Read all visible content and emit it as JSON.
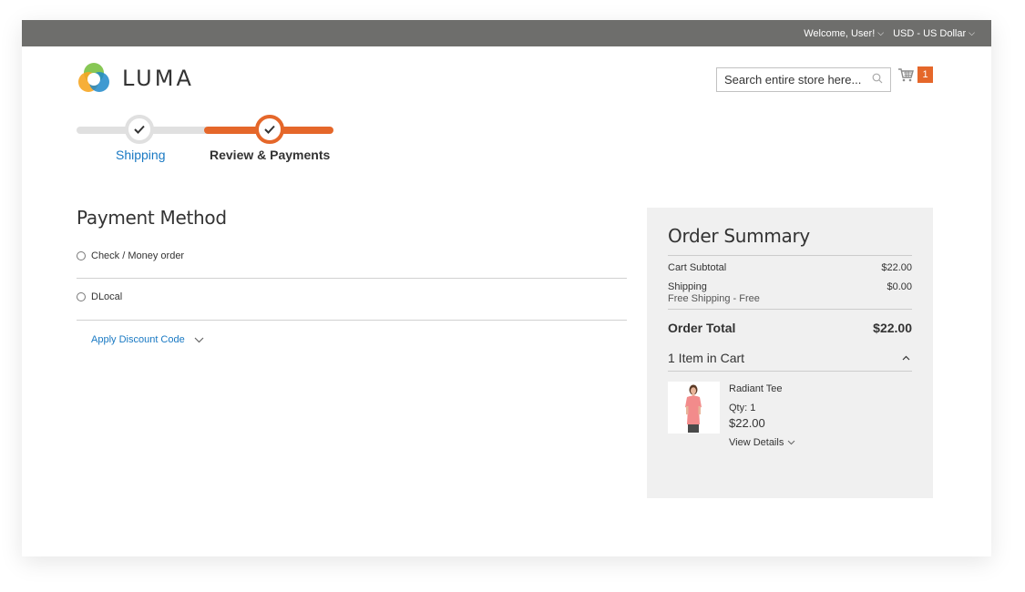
{
  "topbar": {
    "welcome": "Welcome, User!",
    "currency": "USD - US Dollar"
  },
  "header": {
    "logo_text": "LUMA",
    "search_placeholder": "Search entire store here...",
    "cart_count": "1"
  },
  "progress": {
    "steps": [
      {
        "label": "Shipping",
        "state": "complete"
      },
      {
        "label": "Review & Payments",
        "state": "active"
      }
    ]
  },
  "payment": {
    "title": "Payment Method",
    "options": [
      "Check / Money order",
      "DLocal"
    ],
    "discount_label": "Apply Discount Code"
  },
  "summary": {
    "title": "Order Summary",
    "subtotal_label": "Cart Subtotal",
    "subtotal_value": "$22.00",
    "shipping_label": "Shipping",
    "shipping_method": "Free Shipping - Free",
    "shipping_value": "$0.00",
    "total_label": "Order Total",
    "total_value": "$22.00",
    "items_label": "1 Item in Cart",
    "item": {
      "name": "Radiant Tee",
      "qty": "Qty: 1",
      "price": "$22.00",
      "details_label": "View Details"
    }
  },
  "colors": {
    "accent": "#e5672a",
    "link": "#1979c3",
    "topbar": "#6e6e6c",
    "summary_bg": "#f0f0f0"
  }
}
